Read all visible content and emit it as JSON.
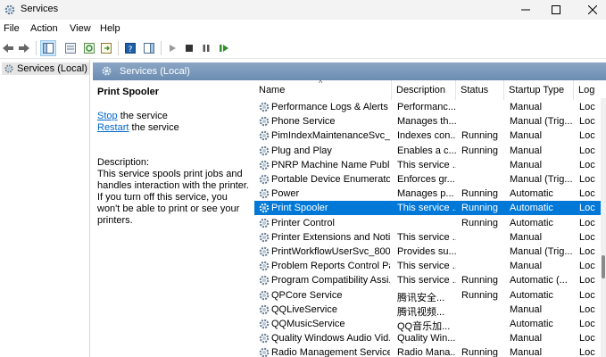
{
  "window": {
    "title": "Services"
  },
  "menu": [
    "File",
    "Action",
    "View",
    "Help"
  ],
  "tree": {
    "item": "Services (Local)"
  },
  "pane": {
    "header": "Services (Local)"
  },
  "detail": {
    "title": "Print Spooler",
    "stop_link": "Stop",
    "stop_suffix": " the service",
    "restart_link": "Restart",
    "restart_suffix": " the service",
    "description_label": "Description:",
    "description": "This service spools print jobs and handles interaction with the printer. If you turn off this service, you won't be able to print or see your printers."
  },
  "columns": [
    "Name",
    "Description",
    "Status",
    "Startup Type",
    "Log"
  ],
  "rows": [
    {
      "name": "Performance Logs & Alerts",
      "description": "Performanc...",
      "status": "",
      "startup": "Manual",
      "log": "Loc"
    },
    {
      "name": "Phone Service",
      "description": "Manages th...",
      "status": "",
      "startup": "Manual (Trig...",
      "log": "Loc"
    },
    {
      "name": "PimIndexMaintenanceSvc_...",
      "description": "Indexes con...",
      "status": "Running",
      "startup": "Manual",
      "log": "Loc"
    },
    {
      "name": "Plug and Play",
      "description": "Enables a c...",
      "status": "Running",
      "startup": "Manual",
      "log": "Loc"
    },
    {
      "name": "PNRP Machine Name Publi...",
      "description": "This service ...",
      "status": "",
      "startup": "Manual",
      "log": "Loc"
    },
    {
      "name": "Portable Device Enumerator...",
      "description": "Enforces gr...",
      "status": "",
      "startup": "Manual (Trig...",
      "log": "Loc"
    },
    {
      "name": "Power",
      "description": "Manages p...",
      "status": "Running",
      "startup": "Automatic",
      "log": "Loc"
    },
    {
      "name": "Print Spooler",
      "description": "This service ...",
      "status": "Running",
      "startup": "Automatic",
      "log": "Loc"
    },
    {
      "name": "Printer Control",
      "description": "",
      "status": "Running",
      "startup": "Automatic",
      "log": "Loc"
    },
    {
      "name": "Printer Extensions and Notif...",
      "description": "This service ...",
      "status": "",
      "startup": "Manual",
      "log": "Loc"
    },
    {
      "name": "PrintWorkflowUserSvc_8003d",
      "description": "Provides su...",
      "status": "",
      "startup": "Manual (Trig...",
      "log": "Loc"
    },
    {
      "name": "Problem Reports Control Pa...",
      "description": "This service ...",
      "status": "",
      "startup": "Manual",
      "log": "Loc"
    },
    {
      "name": "Program Compatibility Assi...",
      "description": "This service ...",
      "status": "Running",
      "startup": "Automatic (...",
      "log": "Loc"
    },
    {
      "name": "QPCore Service",
      "description": "腾讯安全...",
      "status": "Running",
      "startup": "Automatic",
      "log": "Loc"
    },
    {
      "name": "QQLiveService",
      "description": "腾讯视频...",
      "status": "",
      "startup": "Manual",
      "log": "Loc"
    },
    {
      "name": "QQMusicService",
      "description": "QQ音乐加...",
      "status": "",
      "startup": "Automatic",
      "log": "Loc"
    },
    {
      "name": "Quality Windows Audio Vid...",
      "description": "Quality Win...",
      "status": "",
      "startup": "Manual",
      "log": "Loc"
    },
    {
      "name": "Radio Management Service",
      "description": "Radio Mana...",
      "status": "Running",
      "startup": "Manual",
      "log": "Loc"
    }
  ],
  "selected_row": "Print Spooler",
  "colors": {
    "selection": "#0078d7",
    "header": "#6d8fb3",
    "link": "#0066cc"
  }
}
